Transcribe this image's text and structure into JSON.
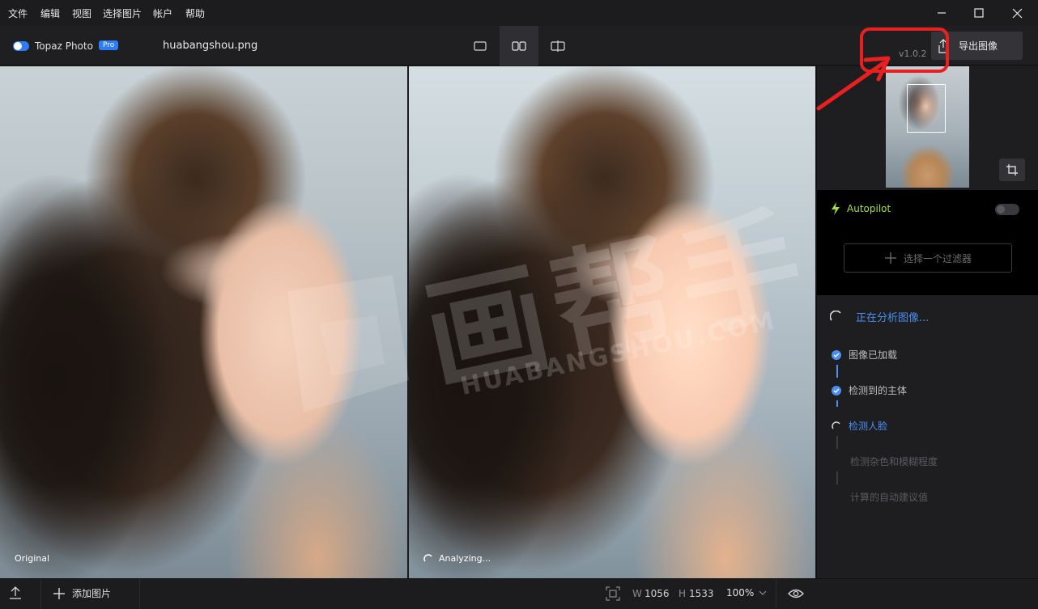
{
  "menubar": {
    "items": [
      "文件",
      "编辑",
      "视图",
      "选择图片",
      "帐户",
      "帮助"
    ],
    "window_controls": [
      "minimize-icon",
      "maximize-icon",
      "close-icon"
    ]
  },
  "toolbar": {
    "app_name": "Topaz Photo",
    "plan_badge": "Pro",
    "file_name": "huabangshou.png",
    "version": "v1.0.2",
    "export_label": "导出图像",
    "view_modes": [
      "single-view-icon",
      "side-by-side-icon",
      "split-view-icon"
    ],
    "active_view": "side-by-side-icon"
  },
  "panes": {
    "left_label": "Original",
    "right_label": "Analyzing..."
  },
  "watermark": {
    "main": "画帮手",
    "sub": "HUABANGSHOU.COM"
  },
  "panel": {
    "autopilot_label": "Autopilot",
    "autopilot_on": false,
    "filter_placeholder": "选择一个过滤器",
    "analysis_title": "正在分析图像...",
    "steps": [
      {
        "label": "图像已加载",
        "state": "done"
      },
      {
        "label": "检测到的主体",
        "state": "done"
      },
      {
        "label": "检测人脸",
        "state": "active"
      },
      {
        "label": "检测杂色和模糊程度",
        "state": "pending"
      },
      {
        "label": "计算的自动建议值",
        "state": "pending"
      }
    ]
  },
  "bottombar": {
    "add_image_label": "添加图片",
    "width_label": "W",
    "width_value": "1056",
    "height_label": "H",
    "height_value": "1533",
    "zoom": "100%"
  },
  "colors": {
    "accent": "#2e7cf6",
    "autopilot_green": "#a6e22e",
    "step_blue": "#4a8ff0",
    "annotation_red": "#e82020"
  }
}
